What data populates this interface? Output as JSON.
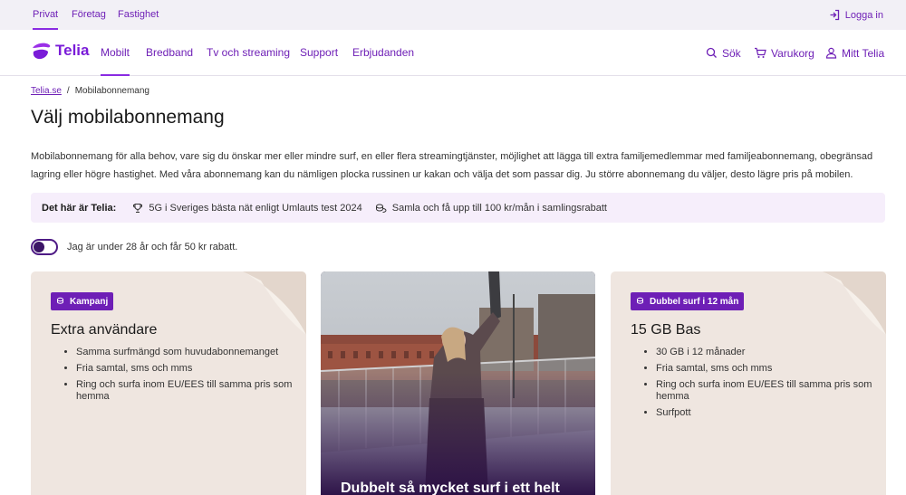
{
  "topbar": {
    "segments": [
      "Privat",
      "Företag",
      "Fastighet"
    ],
    "login_label": "Logga in"
  },
  "nav": {
    "logo_text": "Telia",
    "links": [
      "Mobilt",
      "Bredband",
      "Tv och streaming",
      "Support",
      "Erbjudanden"
    ],
    "active": "Mobilt",
    "search_label": "Sök",
    "cart_label": "Varukorg",
    "account_label": "Mitt Telia"
  },
  "breadcrumb": {
    "home": "Telia.se",
    "separator": "/",
    "current": "Mobilabonnemang"
  },
  "page": {
    "title": "Välj mobilabonnemang",
    "intro": "Mobilabonnemang för alla behov, vare sig du önskar mer eller mindre surf, en eller flera streamingtjänster, möjlighet att lägga till extra familjemedlemmar med familjeabonnemang, obegränsad lagring eller högre hastighet. Med våra abonnemang kan du nämligen plocka russinen ur kakan och välja det som passar dig. Ju större abonnemang du väljer, desto lägre pris på mobilen."
  },
  "infobar": {
    "title": "Det här är Telia:",
    "item1": "5G i Sveriges bästa nät enligt Umlauts test 2024",
    "item2": "Samla och få upp till 100 kr/mån i samlingsrabatt"
  },
  "toggle": {
    "label": "Jag är under 28 år och får 50 kr rabatt.",
    "on": false
  },
  "cards": [
    {
      "badge": "Kampanj",
      "title": "Extra användare",
      "features": [
        "Samma surfmängd som huvudabonnemanget",
        "Fria samtal, sms och mms",
        "Ring och surfa inom EU/EES till samma pris som hemma"
      ]
    },
    {
      "title": "Dubbelt så mycket surf i ett helt"
    },
    {
      "badge": "Dubbel surf i 12 mån",
      "title": "15 GB Bas",
      "features": [
        "30 GB i 12 månader",
        "Fria samtal, sms och mms",
        "Ring och surfa inom EU/EES till samma pris som hemma",
        "Surfpott"
      ]
    }
  ],
  "colors": {
    "brand": "#6e1fb6",
    "infobar_bg": "#f6eefb",
    "card_bg": "#efe6e0"
  }
}
